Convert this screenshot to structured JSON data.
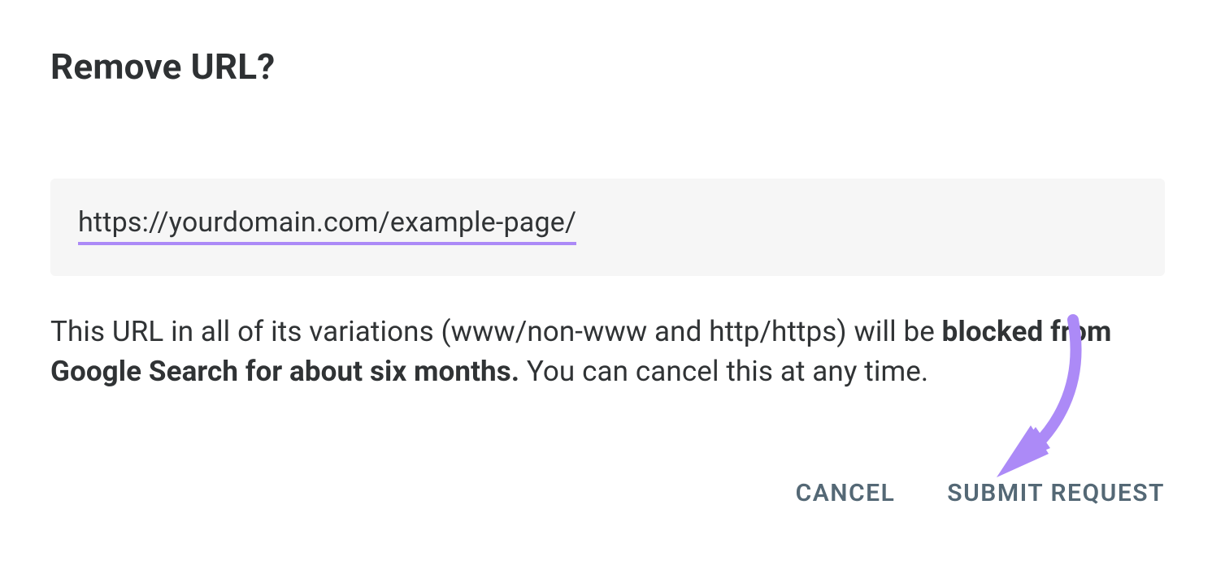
{
  "dialog": {
    "title": "Remove URL?",
    "url_value": "https://yourdomain.com/example-page/",
    "description_prefix": "This URL in all of its variations (www/non-www and http/https) will be ",
    "description_bold": "blocked from Google Search for about six months.",
    "description_suffix": " You can cancel this at any time.",
    "cancel_label": "CANCEL",
    "submit_label": "SUBMIT REQUEST"
  },
  "annotation": {
    "underline_color": "#ac8af7",
    "arrow_color": "#ac8af7"
  }
}
